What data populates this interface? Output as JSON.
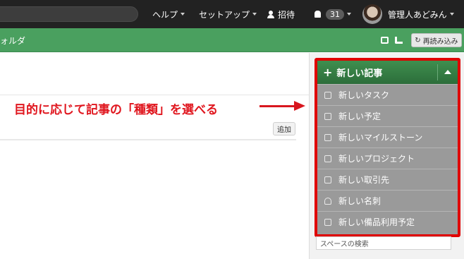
{
  "header": {
    "help": "ヘルプ",
    "setup": "セットアップ",
    "invite": "招待",
    "notification_count": "31",
    "user_name": "管理人あどみん"
  },
  "toolbar": {
    "folder_label": "ォルダ",
    "reload_label": "再読み込み"
  },
  "content": {
    "add_label": "追加",
    "annotation": "目的に応じて記事の「種類」を選べる"
  },
  "new_article_menu": {
    "title": "新しい記事",
    "items": [
      {
        "label": "新しいタスク",
        "icon": "task-check-icon"
      },
      {
        "label": "新しい予定",
        "icon": "calendar-icon"
      },
      {
        "label": "新しいマイルストーン",
        "icon": "calendar-icon"
      },
      {
        "label": "新しいプロジェクト",
        "icon": "project-icon"
      },
      {
        "label": "新しい取引先",
        "icon": "building-icon"
      },
      {
        "label": "新しい名刺",
        "icon": "person-icon"
      },
      {
        "label": "新しい備品利用予定",
        "icon": "calendar-icon"
      }
    ]
  },
  "sidebar": {
    "space_search_placeholder": "スペースの検索"
  },
  "colors": {
    "topbar": "#222222",
    "greenbar": "#4aa05f",
    "menu_header": "#2f7640",
    "highlight": "#e00000"
  }
}
